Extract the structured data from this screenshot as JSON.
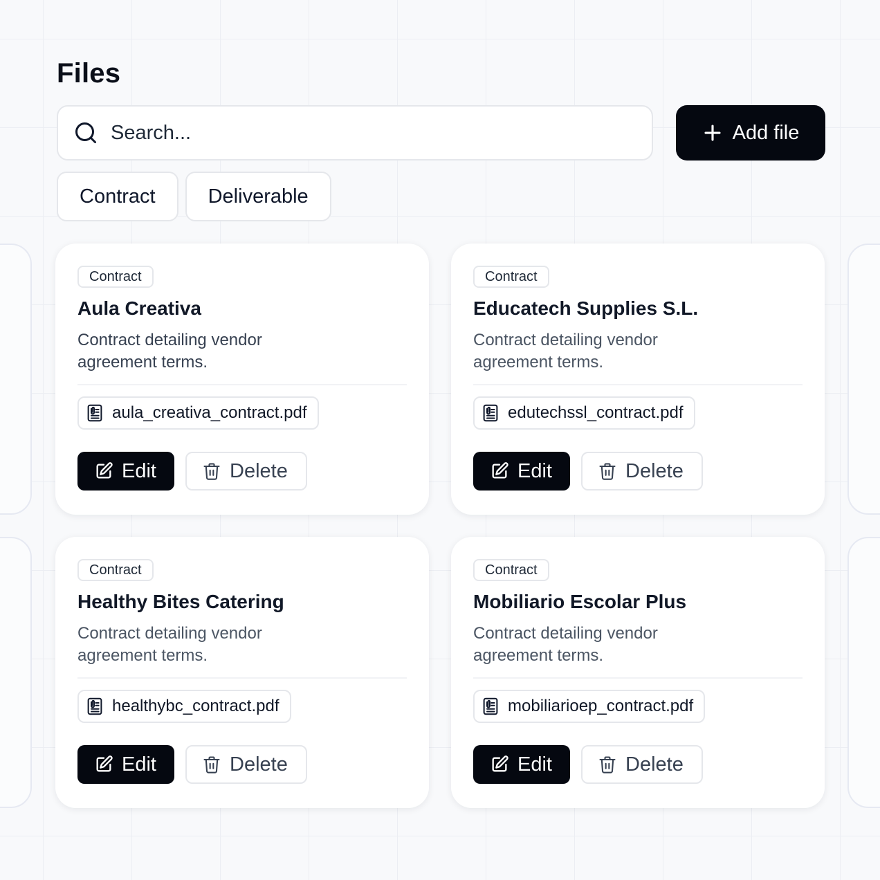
{
  "page": {
    "title": "Files"
  },
  "search": {
    "placeholder": "Search..."
  },
  "toolbar": {
    "add_label": "Add file"
  },
  "filters": [
    "Contract",
    "Deliverable"
  ],
  "cards": [
    {
      "tag": "Contract",
      "name": "Aula Creativa",
      "description": "Contract detailing vendor agreement terms.",
      "file": "aula_creativa_contract.pdf",
      "edit_label": "Edit",
      "delete_label": "Delete"
    },
    {
      "tag": "Contract",
      "name": "Educatech Supplies S.L.",
      "description": "Contract detailing vendor agreement terms.",
      "file": "edutechssl_contract.pdf",
      "edit_label": "Edit",
      "delete_label": "Delete"
    },
    {
      "tag": "Contract",
      "name": "Healthy Bites Catering",
      "description": "Contract detailing vendor agreement terms.",
      "file": "healthybc_contract.pdf",
      "edit_label": "Edit",
      "delete_label": "Delete"
    },
    {
      "tag": "Contract",
      "name": "Mobiliario Escolar Plus",
      "description": "Contract detailing vendor agreement terms.",
      "file": "mobiliarioep_contract.pdf",
      "edit_label": "Edit",
      "delete_label": "Delete"
    }
  ],
  "icons": {
    "search": "search-icon",
    "add": "plus-icon",
    "file": "file-signature-icon",
    "edit": "edit-icon",
    "delete": "trash-icon"
  },
  "colors": {
    "primary": "#050810",
    "border": "#e5e7eb",
    "background": "#f8f9fb"
  }
}
